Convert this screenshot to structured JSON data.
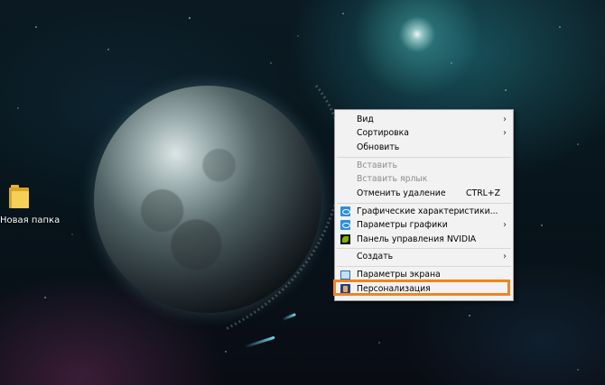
{
  "desktop": {
    "icons": [
      {
        "label": "Новая папка",
        "icon": "folder-icon"
      }
    ]
  },
  "context_menu": {
    "items": {
      "view": {
        "label": "Вид",
        "submenu": true
      },
      "sort": {
        "label": "Сортировка",
        "submenu": true
      },
      "refresh": {
        "label": "Обновить"
      },
      "paste": {
        "label": "Вставить",
        "disabled": true
      },
      "paste_shortcut": {
        "label": "Вставить ярлык",
        "disabled": true
      },
      "undo_delete": {
        "label": "Отменить удаление",
        "shortcut": "CTRL+Z"
      },
      "graphics_properties": {
        "label": "Графические характеристики...",
        "icon": "intel-graphics-icon"
      },
      "graphics_options": {
        "label": "Параметры графики",
        "icon": "intel-graphics-icon",
        "submenu": true
      },
      "nvidia_panel": {
        "label": "Панель управления NVIDIA",
        "icon": "nvidia-icon"
      },
      "new": {
        "label": "Создать",
        "submenu": true
      },
      "display_settings": {
        "label": "Параметры экрана",
        "icon": "display-icon"
      },
      "personalize": {
        "label": "Персонализация",
        "icon": "personalize-icon",
        "highlighted": true
      }
    }
  },
  "colors": {
    "highlight_border": "#f0841f",
    "menu_background": "#f2f2f2",
    "disabled_text": "#8c8c8c"
  }
}
